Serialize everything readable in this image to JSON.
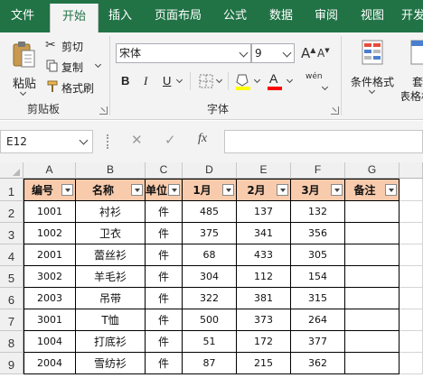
{
  "ribbon_tabs": [
    "文件",
    "开始",
    "插入",
    "页面布局",
    "公式",
    "数据",
    "审阅",
    "视图",
    "开发"
  ],
  "clipboard": {
    "paste": "粘贴",
    "cut": "剪切",
    "copy": "复制",
    "format_painter": "格式刷",
    "group_label": "剪贴板"
  },
  "font": {
    "name": "宋体",
    "size": "9",
    "bold": "B",
    "italic": "I",
    "underline": "U",
    "grow": "A",
    "shrink": "A",
    "font_color_glyph": "A",
    "phonetic": "wén",
    "group_label": "字体"
  },
  "styles": {
    "conditional_formatting": "条件格式",
    "format_as_table_1": "套",
    "format_as_table_2": "表格格"
  },
  "formula_bar": {
    "name_box": "E12",
    "cancel": "✕",
    "enter": "✓",
    "fx": "fx",
    "formula": ""
  },
  "colors": {
    "excel_green": "#217346",
    "header_fill": "#f8cbad",
    "highlight_yellow": "#ffff00",
    "font_red": "#ff0000"
  },
  "icons": [
    "paste-icon",
    "scissors-icon",
    "copy-icon",
    "format-painter-icon",
    "borders-icon",
    "fill-color-icon",
    "font-color-icon",
    "conditional-format-icon",
    "dropdown-chevron-icon",
    "filter-arrow-icon"
  ],
  "columns": [
    "A",
    "B",
    "C",
    "D",
    "E",
    "F",
    "G"
  ],
  "rows": [
    "1",
    "2",
    "3",
    "4",
    "5",
    "6",
    "7",
    "8",
    "9"
  ],
  "table": {
    "headers": [
      "编号",
      "名称",
      "单位",
      "1月",
      "2月",
      "3月",
      "备注"
    ],
    "data": [
      [
        "1001",
        "衬衫",
        "件",
        "485",
        "137",
        "132",
        ""
      ],
      [
        "1002",
        "卫衣",
        "件",
        "375",
        "341",
        "356",
        ""
      ],
      [
        "2001",
        "蕾丝衫",
        "件",
        "68",
        "433",
        "305",
        ""
      ],
      [
        "3002",
        "羊毛衫",
        "件",
        "304",
        "112",
        "154",
        ""
      ],
      [
        "2003",
        "吊带",
        "件",
        "322",
        "381",
        "315",
        ""
      ],
      [
        "3001",
        "T恤",
        "件",
        "500",
        "373",
        "264",
        ""
      ],
      [
        "1004",
        "打底衫",
        "件",
        "51",
        "172",
        "377",
        ""
      ],
      [
        "2004",
        "雪纺衫",
        "件",
        "87",
        "215",
        "362",
        ""
      ]
    ]
  }
}
